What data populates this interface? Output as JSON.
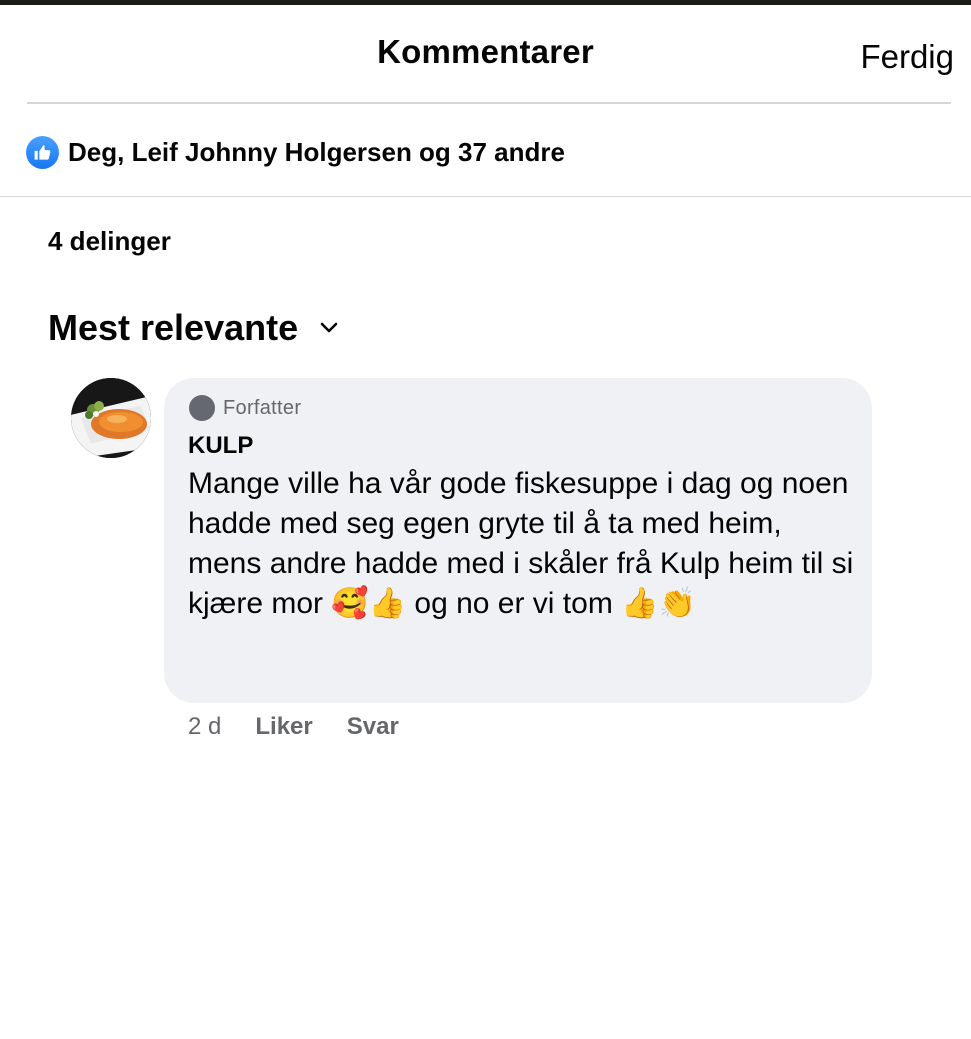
{
  "header": {
    "title": "Kommentarer",
    "done_label": "Ferdig"
  },
  "reactions": {
    "icon": "like-icon",
    "text": "Deg, Leif Johnny Holgersen og 37 andre",
    "accent_color": "#1877f2"
  },
  "shares": {
    "text": "4 delinger"
  },
  "sort": {
    "label": "Mest relevante",
    "icon": "chevron-down-icon"
  },
  "comment": {
    "badge": "Forfatter",
    "author": "KULP",
    "text": "Mange ville ha vår gode fiskesuppe i dag og noen hadde med seg egen gryte til å ta med heim, mens andre hadde med i skåler frå Kulp heim til si kjære mor 🥰👍 og no er vi tom 👍👏",
    "time": "2 d",
    "like_label": "Liker",
    "reply_label": "Svar",
    "bubble_color": "#f0f1f4"
  }
}
